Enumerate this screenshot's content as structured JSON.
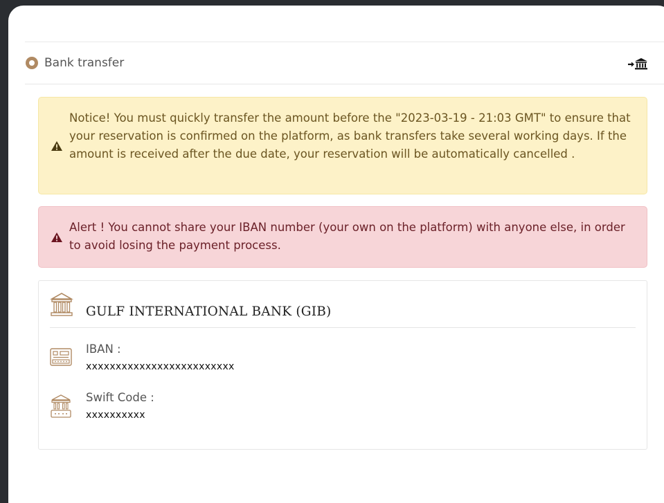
{
  "payment_method": {
    "label": "Bank transfer",
    "icon": "bank-transfer-icon",
    "selected": true
  },
  "notice": {
    "text": "Notice! You must quickly transfer the amount before the \"2023-03-19 - 21:03 GMT\" to ensure that your reservation is confirmed on the platform, as bank transfers take several working days. If the amount is received after the due date, your reservation will be automatically cancelled .",
    "icon": "warning-icon"
  },
  "alert": {
    "text": "Alert ! You cannot share your IBAN number (your own on the platform) with anyone else, in order to avoid losing the payment process.",
    "icon": "warning-icon"
  },
  "bank": {
    "name": "GULF INTERNATIONAL BANK (GIB)",
    "icon": "bank-building-icon",
    "iban_label": "IBAN :",
    "iban_value": "xxxxxxxxxxxxxxxxxxxxxxxxx",
    "swift_label": "Swift Code :",
    "swift_value": "xxxxxxxxxx"
  },
  "colors": {
    "accent": "#b08a63",
    "notice_bg": "#fdf2c8",
    "alert_bg": "#f7d5d8",
    "backdrop": "#2a2d31"
  }
}
